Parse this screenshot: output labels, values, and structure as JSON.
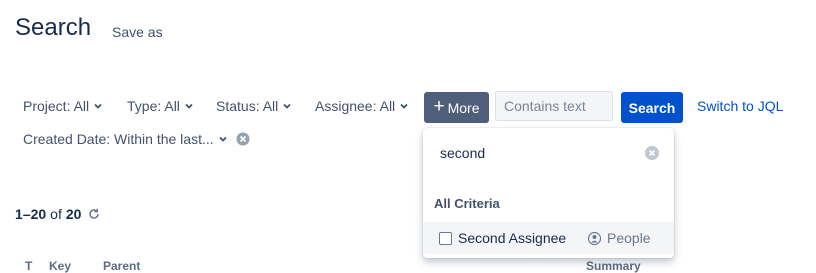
{
  "header": {
    "title": "Search",
    "save_as": "Save as"
  },
  "filters": {
    "project": "Project: All",
    "type": "Type: All",
    "status": "Status: All",
    "assignee": "Assignee: All",
    "more": "More",
    "text_placeholder": "Contains text",
    "search": "Search",
    "switch_jql": "Switch to JQL",
    "created_date": "Created Date: Within the last..."
  },
  "results": {
    "range": "1–20",
    "of": "of",
    "total": "20"
  },
  "columns": {
    "t": "T",
    "key": "Key",
    "parent": "Parent",
    "summary": "Summary"
  },
  "dropdown": {
    "query": "second",
    "heading": "All Criteria",
    "option": {
      "label": "Second Assignee",
      "category": "People",
      "checked": false
    }
  },
  "colors": {
    "primary": "#0052cc",
    "more_button": "#505f79",
    "text": "#172b4d",
    "subtle": "#42526e"
  }
}
